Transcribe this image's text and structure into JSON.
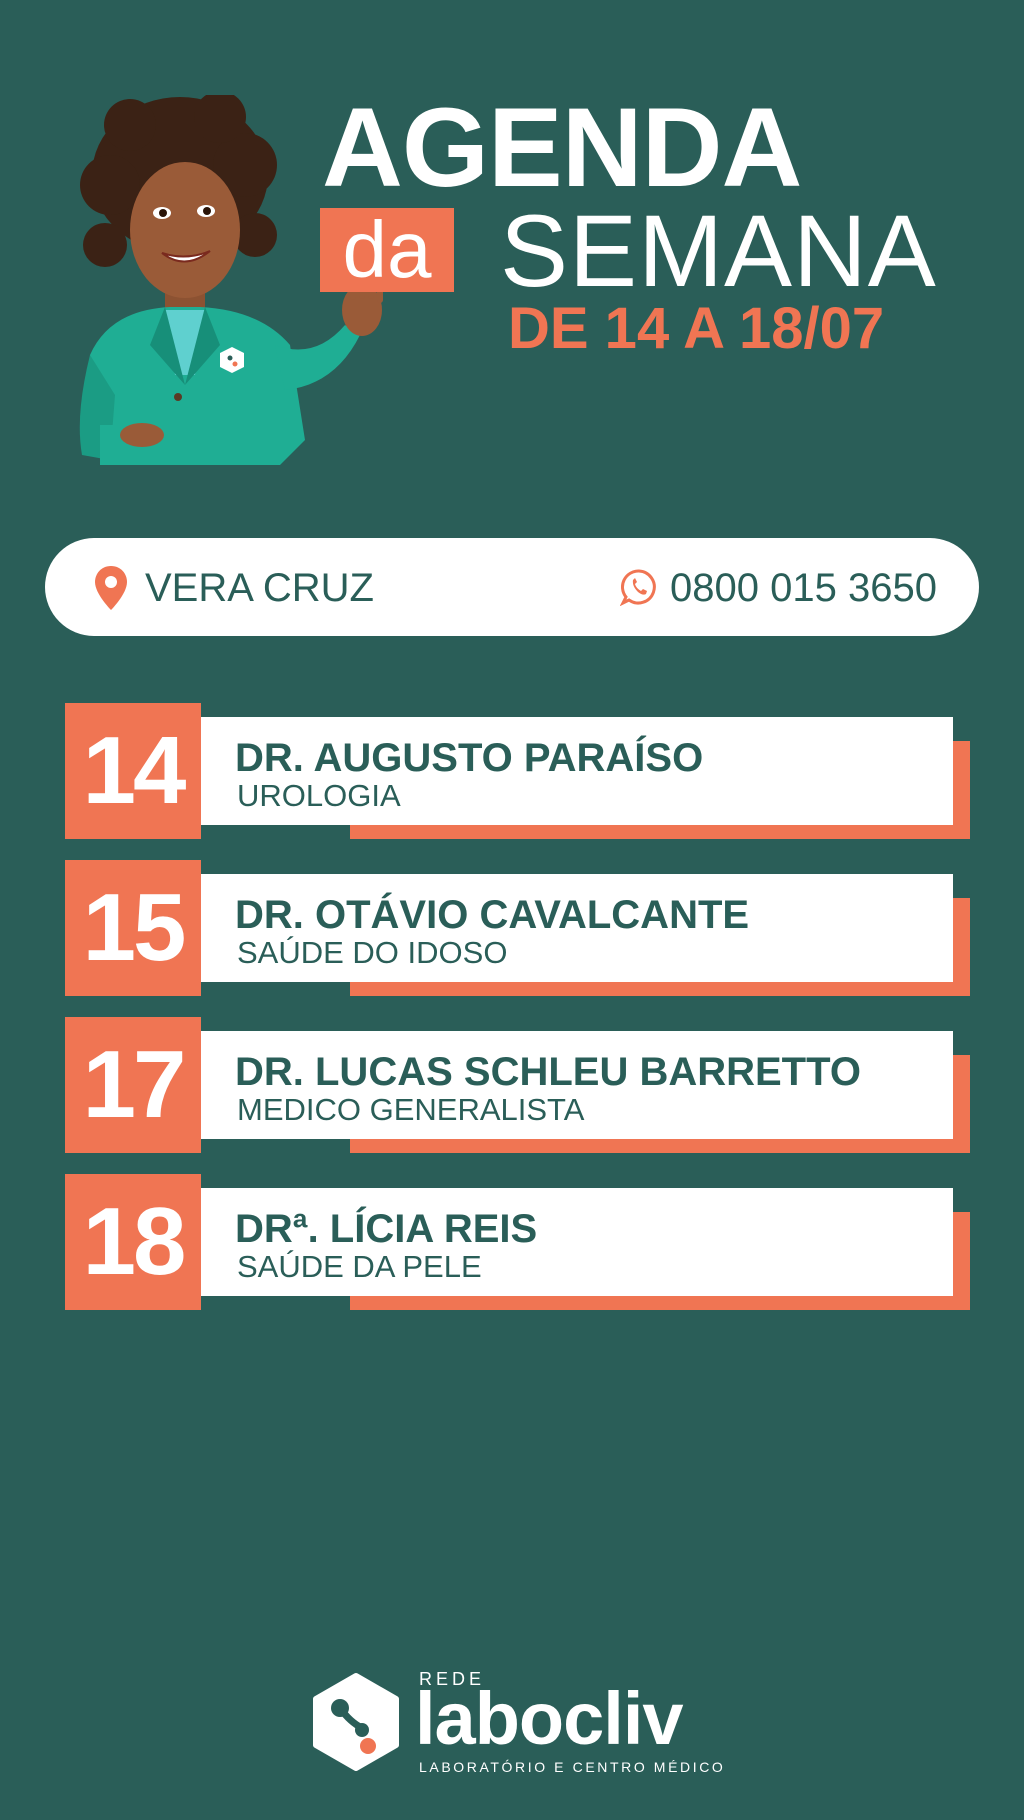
{
  "header": {
    "title_line1": "AGENDA",
    "title_da": "da",
    "title_line2": "SEMANA",
    "dates": "DE 14 A 18/07"
  },
  "info_bar": {
    "location": "VERA CRUZ",
    "phone": "0800 015 3650",
    "location_icon": "map-pin-icon",
    "phone_icon": "whatsapp-icon"
  },
  "schedule": [
    {
      "day": "14",
      "doctor": "DR. AUGUSTO PARAÍSO",
      "specialty": "UROLOGIA"
    },
    {
      "day": "15",
      "doctor": "DR. OTÁVIO CAVALCANTE",
      "specialty": "SAÚDE DO IDOSO"
    },
    {
      "day": "17",
      "doctor": "DR. LUCAS SCHLEU BARRETTO",
      "specialty": "MEDICO GENERALISTA"
    },
    {
      "day": "18",
      "doctor": "DRª. LÍCIA REIS",
      "specialty": "SAÚDE DA PELE"
    }
  ],
  "logo": {
    "prefix": "REDE",
    "name": "labocliv",
    "tagline": "LABORATÓRIO E CENTRO MÉDICO"
  },
  "colors": {
    "background": "#2a5e58",
    "accent": "#f07553",
    "white": "#ffffff",
    "mascot_blazer": "#1fae94"
  }
}
